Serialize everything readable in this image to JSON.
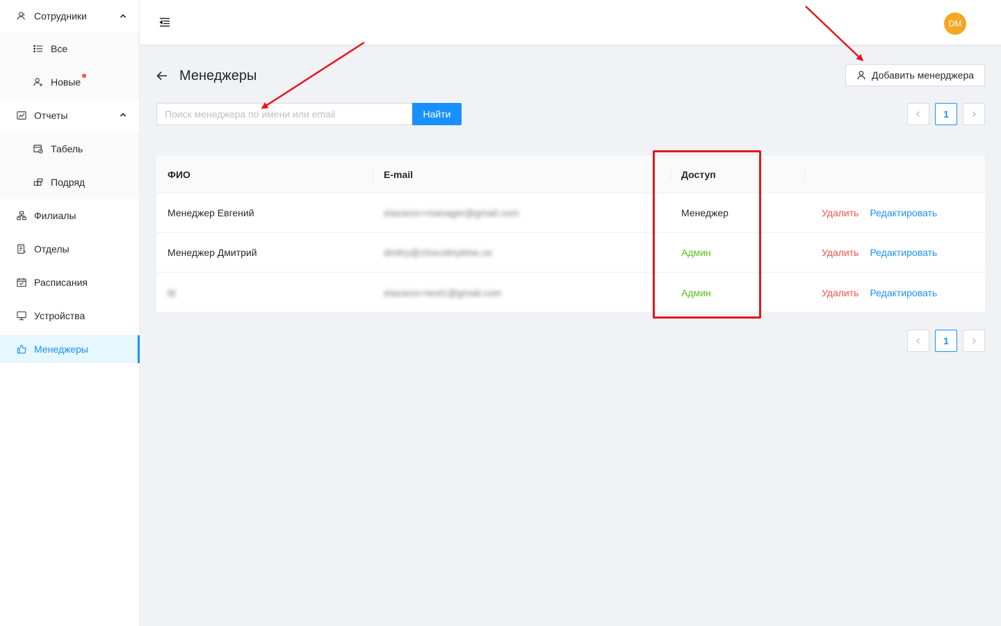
{
  "sidebar": {
    "items": [
      {
        "label": "Сотрудники",
        "icon": "users-icon",
        "expanded": true,
        "children": [
          {
            "label": "Все",
            "icon": "list-icon"
          },
          {
            "label": "Новые",
            "icon": "user-add-icon",
            "badge_dot": true
          }
        ]
      },
      {
        "label": "Отчеты",
        "icon": "line-chart-icon",
        "expanded": true,
        "children": [
          {
            "label": "Табель",
            "icon": "timesheet-icon"
          },
          {
            "label": "Подряд",
            "icon": "blocks-icon"
          }
        ]
      },
      {
        "label": "Филиалы",
        "icon": "branches-icon"
      },
      {
        "label": "Отделы",
        "icon": "departments-icon"
      },
      {
        "label": "Расписания",
        "icon": "calendar-icon"
      },
      {
        "label": "Устройства",
        "icon": "desktop-icon"
      },
      {
        "label": "Менеджеры",
        "icon": "like-icon",
        "active": true
      }
    ]
  },
  "header": {
    "avatar_initials": "DM",
    "avatar_color": "#f5a623"
  },
  "page": {
    "title": "Менеджеры",
    "add_button_label": "Добавить менерджера",
    "search": {
      "placeholder": "Поиск менеджера по имени или email",
      "value": "",
      "button_label": "Найти"
    },
    "pagination": {
      "current_page": "1"
    }
  },
  "table": {
    "columns": [
      "ФИО",
      "E-mail",
      "Доступ",
      ""
    ],
    "rows": [
      {
        "name": "Менеджер Евгений",
        "email": "elazarov+manager@gmail.com",
        "role": "Менеджер",
        "role_color": "#000000d9"
      },
      {
        "name": "Менеджер Дмитрий",
        "email": "dmitry@chocolinytime.ce",
        "role": "Админ",
        "role_color": "#52c41a"
      },
      {
        "name": "ttt",
        "email": "elazarov+test1@gmail.com",
        "role": "Админ",
        "role_color": "#52c41a"
      }
    ],
    "actions": {
      "delete_label": "Удалить",
      "edit_label": "Редактировать"
    }
  },
  "colors": {
    "primary": "#1890ff",
    "danger": "#ff4d4f",
    "success": "#52c41a",
    "annotation": "#e5161b"
  }
}
